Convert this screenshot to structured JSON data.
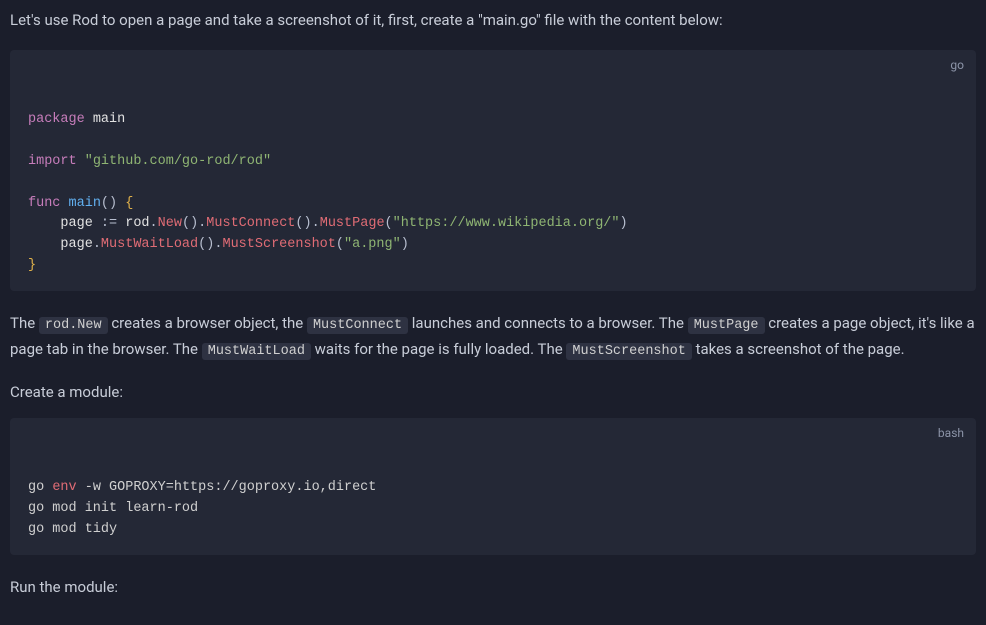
{
  "para1": "Let's use Rod to open a page and take a screenshot of it, first, create a \"main.go\" file with the content below:",
  "code1": {
    "lang": "go",
    "t": {
      "pkg_kw": "package",
      "pkg_name": "main",
      "import_kw": "import",
      "import_path": "\"github.com/go-rod/rod\"",
      "func_kw": "func",
      "main_name": "main",
      "lparen": "(",
      "rparen": ")",
      "lbrace": "{",
      "rbrace": "}",
      "indent": "    ",
      "page_var": "page",
      "assign": " := ",
      "rod_id": "rod",
      "dot": ".",
      "new_call": "New",
      "mustconnect": "MustConnect",
      "mustpage": "MustPage",
      "url": "\"https://www.wikipedia.org/\"",
      "page_id": "page",
      "mustwaitload": "MustWaitLoad",
      "mustscreenshot": "MustScreenshot",
      "png": "\"a.png\""
    }
  },
  "para2": {
    "seg1": "The ",
    "c1": "rod.New",
    "seg2": " creates a browser object, the ",
    "c2": "MustConnect",
    "seg3": " launches and connects to a browser. The ",
    "c3": "MustPage",
    "seg4": " creates a page object, it's like a page tab in the browser. The ",
    "c4": "MustWaitLoad",
    "seg5": " waits for the page is fully loaded. The ",
    "c5": "MustScreenshot",
    "seg6": " takes a screenshot of the page."
  },
  "para3": "Create a module:",
  "code2": {
    "lang": "bash",
    "t": {
      "l1a": "go ",
      "l1env": "env",
      "l1b": " -w GOPROXY=https://goproxy.io,direct",
      "l2": "go mod init learn-rod",
      "l3": "go mod tidy"
    }
  },
  "para4": "Run the module:"
}
